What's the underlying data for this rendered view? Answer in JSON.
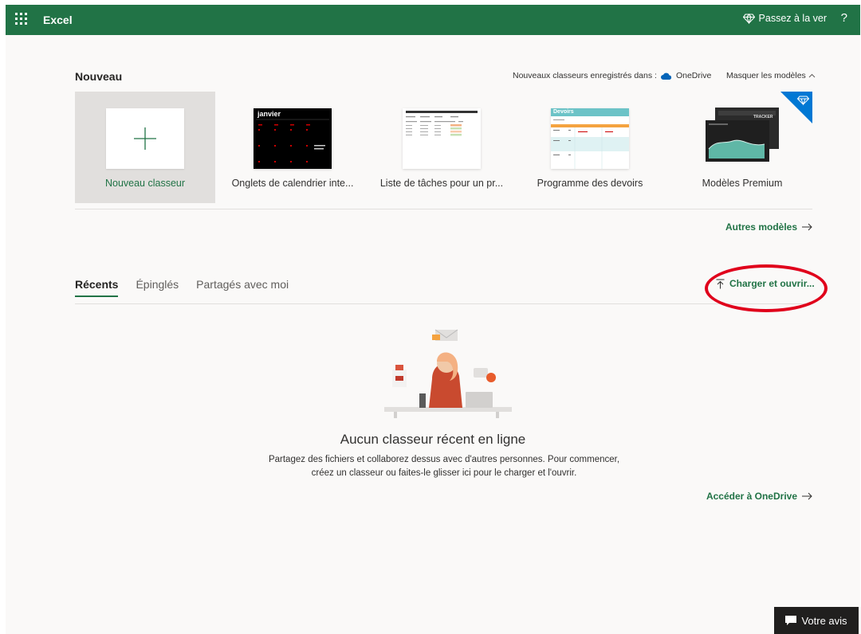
{
  "topbar": {
    "app_name": "Excel",
    "upgrade_label": "Passez à la ver",
    "help_label": "?",
    "colors": {
      "brand": "#217346"
    }
  },
  "new_section": {
    "title": "Nouveau",
    "save_note": "Nouveaux classeurs enregistrés dans :",
    "save_location": "OneDrive",
    "hide_templates": "Masquer les modèles",
    "templates": [
      {
        "label": "Nouveau classeur",
        "icon": "plus-icon"
      },
      {
        "label": "Onglets de calendrier inte...",
        "month": "janvier"
      },
      {
        "label": "Liste de tâches pour un pr..."
      },
      {
        "label": "Programme des devoirs",
        "header": "Devoirs"
      },
      {
        "label": "Modèles Premium",
        "badge_icon": "diamond-icon",
        "thumb_title": "TRACKER"
      }
    ],
    "more_templates": "Autres modèles"
  },
  "recent": {
    "tabs": [
      "Récents",
      "Épinglés",
      "Partagés avec moi"
    ],
    "active_tab": "Récents",
    "upload_label": "Charger et ouvrir...",
    "empty_title": "Aucun classeur récent en ligne",
    "empty_desc_1": "Partagez des fichiers et collaborez dessus avec d'autres personnes. Pour commencer,",
    "empty_desc_2": "créez un classeur ou faites-le glisser ici pour le charger et l'ouvrir.",
    "onedrive_link": "Accéder à OneDrive"
  },
  "feedback": {
    "label": "Votre avis"
  }
}
